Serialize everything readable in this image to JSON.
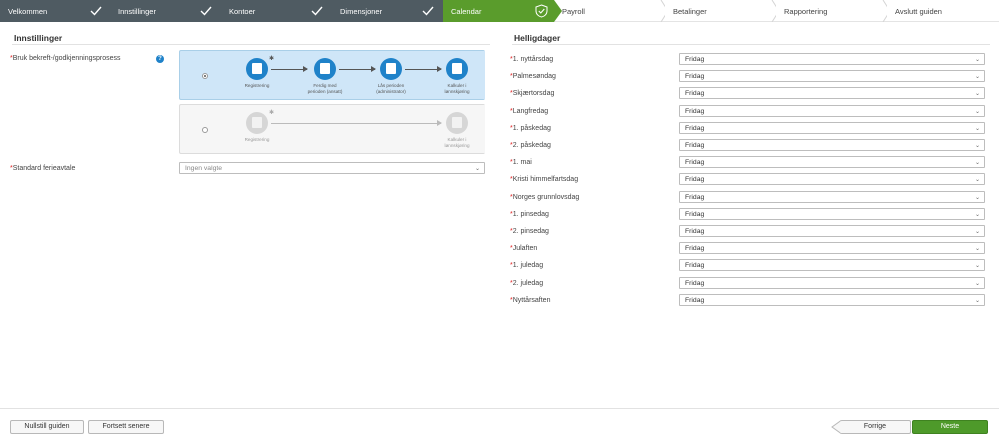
{
  "wizard": {
    "steps": [
      {
        "label": "Velkommen",
        "state": "done"
      },
      {
        "label": "Innstillinger",
        "state": "done"
      },
      {
        "label": "Kontoer",
        "state": "done"
      },
      {
        "label": "Dimensjoner",
        "state": "done"
      },
      {
        "label": "Calendar",
        "state": "current"
      },
      {
        "label": "Payroll",
        "state": "todo"
      },
      {
        "label": "Betalinger",
        "state": "todo"
      },
      {
        "label": "Rapportering",
        "state": "todo"
      },
      {
        "label": "Avslutt guiden",
        "state": "todo"
      }
    ],
    "colors": {
      "done": "#4f5b62",
      "current": "#5a9c2c",
      "primary_button": "#4e9a2a",
      "selected_card": "#cfe6f8",
      "node_blue": "#1f82c9"
    }
  },
  "settings": {
    "title": "Innstillinger",
    "approval_label": "Bruk bekreft-/godkjenningsprosess",
    "help_icon": "?",
    "option_a": {
      "selected": true,
      "nodes": [
        "Registrering",
        "Ferdig med perioden (ansatt)",
        "Lås perioden (administrator)",
        "Kalkuler i lønnskjøring"
      ]
    },
    "option_b": {
      "selected": false,
      "nodes": [
        "Registrering",
        "Kalkuler i lønnskjøring"
      ]
    },
    "vacation_label": "Standard ferieavtale",
    "vacation_placeholder": "Ingen valgte"
  },
  "holidays": {
    "title": "Helligdager",
    "items": [
      {
        "label": "1. nyttårsdag",
        "value": "Fridag"
      },
      {
        "label": "Palmesøndag",
        "value": "Fridag"
      },
      {
        "label": "Skjærtorsdag",
        "value": "Fridag"
      },
      {
        "label": "Langfredag",
        "value": "Fridag"
      },
      {
        "label": "1. påskedag",
        "value": "Fridag"
      },
      {
        "label": "2. påskedag",
        "value": "Fridag"
      },
      {
        "label": "1. mai",
        "value": "Fridag"
      },
      {
        "label": "Kristi himmelfartsdag",
        "value": "Fridag"
      },
      {
        "label": "Norges grunnlovsdag",
        "value": "Fridag"
      },
      {
        "label": "1. pinsedag",
        "value": "Fridag"
      },
      {
        "label": "2. pinsedag",
        "value": "Fridag"
      },
      {
        "label": "Julaften",
        "value": "Fridag"
      },
      {
        "label": "1. juledag",
        "value": "Fridag"
      },
      {
        "label": "2. juledag",
        "value": "Fridag"
      },
      {
        "label": "Nyttårsaften",
        "value": "Fridag"
      }
    ]
  },
  "footer": {
    "reset_label": "Nullstill guiden",
    "later_label": "Fortsett senere",
    "back_label": "Forrige",
    "next_label": "Neste"
  }
}
